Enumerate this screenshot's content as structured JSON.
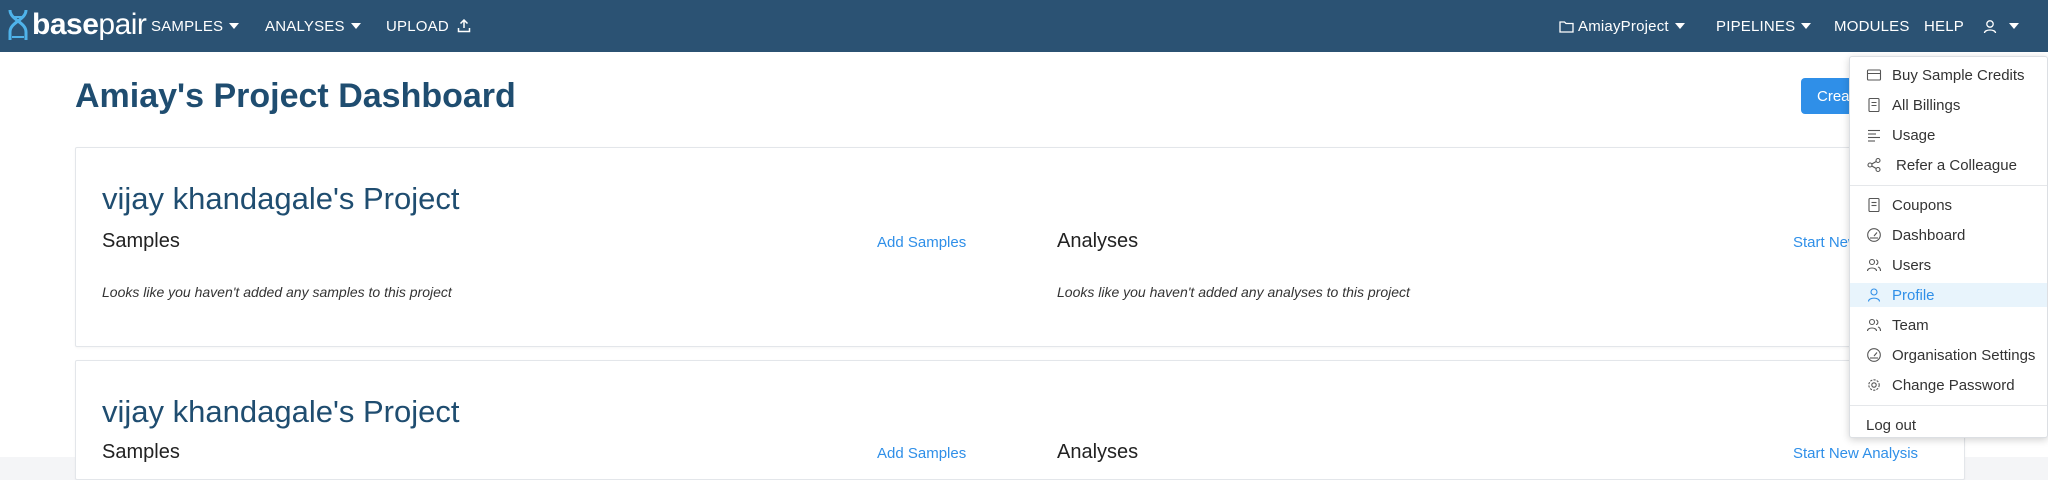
{
  "header": {
    "logo": {
      "bold": "base",
      "regular": "pair"
    },
    "nav": {
      "samples": "SAMPLES",
      "analyses": "ANALYSES",
      "upload": "UPLOAD",
      "project": "AmiayProject",
      "pipelines": "PIPELINES",
      "modules": "MODULES",
      "help": "HELP"
    },
    "icons": {
      "upload": "upload-icon",
      "project": "folder-icon",
      "user": "user-icon"
    }
  },
  "main": {
    "title": "Amiay's Project Dashboard",
    "create_button": "Create"
  },
  "projects": [
    {
      "title": "vijay khandagale's Project",
      "samples_heading": "Samples",
      "add_samples_link": "Add Samples",
      "samples_empty": "Looks like you haven't added any samples to this project",
      "analyses_heading": "Analyses",
      "start_analysis_link": "Start New Analysis",
      "analyses_empty": "Looks like you haven't added any analyses to this project"
    },
    {
      "title": "vijay khandagale's Project",
      "samples_heading": "Samples",
      "add_samples_link": "Add Samples",
      "analyses_heading": "Analyses",
      "start_analysis_link": "Start New Analysis"
    }
  ],
  "user_menu": {
    "items": [
      {
        "label": "Buy Sample Credits",
        "icon": "credit-card-icon"
      },
      {
        "label": "All Billings",
        "icon": "receipt-icon"
      },
      {
        "label": "Usage",
        "icon": "align-left-icon"
      },
      {
        "label": "Refer a Colleague",
        "icon": "share-icon"
      },
      {
        "label": "Coupons",
        "icon": "receipt-icon"
      },
      {
        "label": "Dashboard",
        "icon": "dashboard-icon"
      },
      {
        "label": "Users",
        "icon": "users-icon"
      },
      {
        "label": "Profile",
        "icon": "user-icon",
        "active": true
      },
      {
        "label": "Team",
        "icon": "users-icon"
      },
      {
        "label": "Organisation Settings",
        "icon": "dashboard-icon"
      },
      {
        "label": "Change Password",
        "icon": "gear-icon"
      },
      {
        "label": "Log out"
      }
    ]
  },
  "colors": {
    "header_bg": "#2b5273",
    "title": "#1f4d70",
    "link": "#2f8fe8",
    "active_bg": "#e8f4fc"
  }
}
